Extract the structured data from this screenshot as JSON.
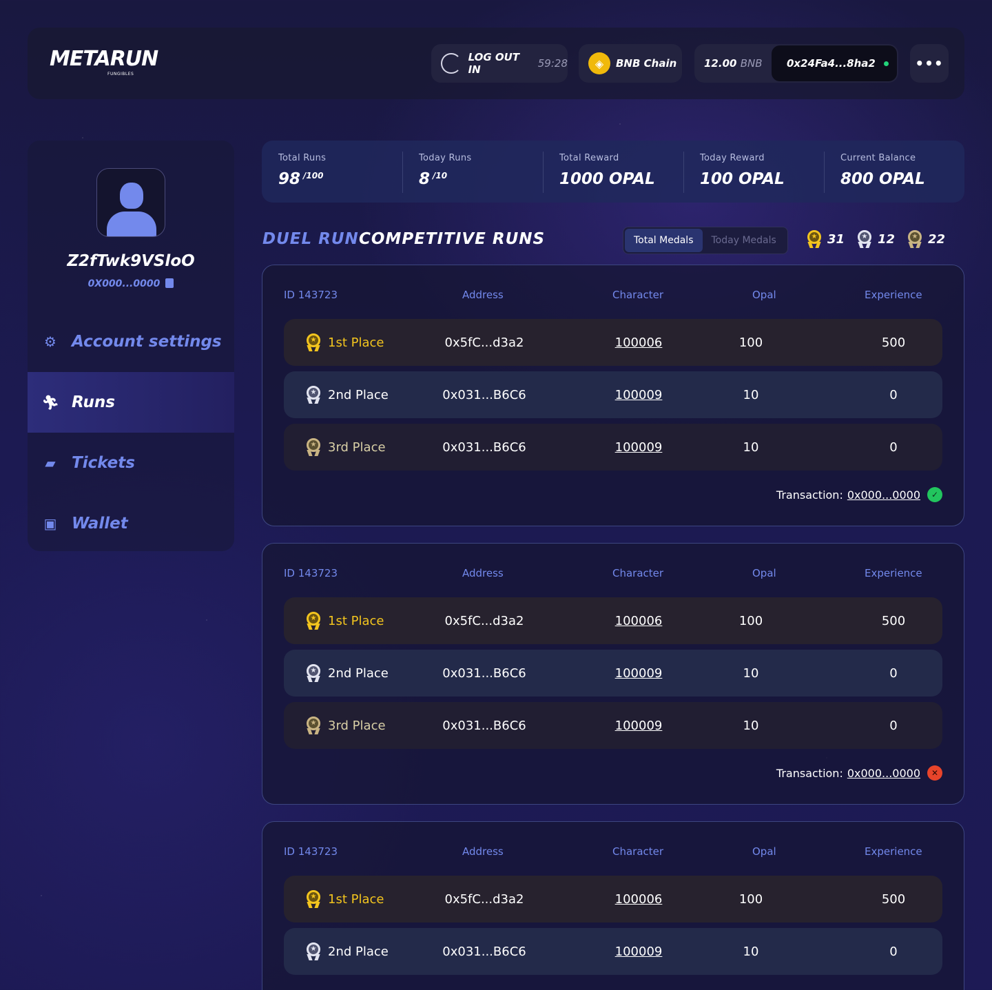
{
  "header": {
    "logo": "METARUN",
    "logo_sub": "FUNGIBLES",
    "logout_label": "LOG OUT IN",
    "logout_timer": "59:28",
    "chain_label": "BNB Chain",
    "balance_amount": "12.00",
    "balance_unit": "BNB",
    "wallet_address": "0x24Fa4...8ha2",
    "more_label": "•••"
  },
  "profile": {
    "username": "Z2fTwk9VSloO",
    "address": "0X000...0000"
  },
  "sidebar": {
    "items": [
      {
        "label": "Account settings",
        "icon": "gear-icon"
      },
      {
        "label": "Runs",
        "icon": "runner-icon"
      },
      {
        "label": "Tickets",
        "icon": "ticket-icon"
      },
      {
        "label": "Wallet",
        "icon": "wallet-icon"
      }
    ]
  },
  "stats": [
    {
      "label": "Total Runs",
      "value": "98",
      "max": "/100"
    },
    {
      "label": "Today Runs",
      "value": "8",
      "max": "/10"
    },
    {
      "label": "Total Reward",
      "value": "1000 OPAL",
      "max": ""
    },
    {
      "label": "Today Reward",
      "value": "100 OPAL",
      "max": ""
    },
    {
      "label": "Current Balance",
      "value": "800 OPAL",
      "max": ""
    }
  ],
  "runs_tabs": {
    "duel": "DUEL RUN",
    "competitive": "COMPETITIVE RUNS"
  },
  "medal_tabs": {
    "total": "Total Medals",
    "today": "Today Medals"
  },
  "medals": {
    "gold": "31",
    "silver": "12",
    "bronze": "22"
  },
  "columns": {
    "address": "Address",
    "character": "Character",
    "opal": "Opal",
    "experience": "Experience"
  },
  "runs": [
    {
      "id": "ID 143723",
      "results": [
        {
          "place": "1st Place",
          "address": "0x5fC...d3a2",
          "character": "100006",
          "opal": "100",
          "experience": "500"
        },
        {
          "place": "2nd Place",
          "address": "0x031...B6C6",
          "character": "100009",
          "opal": "10",
          "experience": "0"
        },
        {
          "place": "3rd Place",
          "address": "0x031...B6C6",
          "character": "100009",
          "opal": "10",
          "experience": "0"
        }
      ],
      "transaction_label": "Transaction:",
      "transaction": "0x000...0000",
      "status": "success"
    },
    {
      "id": "ID 143723",
      "results": [
        {
          "place": "1st Place",
          "address": "0x5fC...d3a2",
          "character": "100006",
          "opal": "100",
          "experience": "500"
        },
        {
          "place": "2nd Place",
          "address": "0x031...B6C6",
          "character": "100009",
          "opal": "10",
          "experience": "0"
        },
        {
          "place": "3rd Place",
          "address": "0x031...B6C6",
          "character": "100009",
          "opal": "10",
          "experience": "0"
        }
      ],
      "transaction_label": "Transaction:",
      "transaction": "0x000...0000",
      "status": "failed"
    },
    {
      "id": "ID 143723",
      "results": [
        {
          "place": "1st Place",
          "address": "0x5fC...d3a2",
          "character": "100006",
          "opal": "100",
          "experience": "500"
        },
        {
          "place": "2nd Place",
          "address": "0x031...B6C6",
          "character": "100009",
          "opal": "10",
          "experience": "0"
        }
      ]
    }
  ],
  "colors": {
    "accent": "#7389ec",
    "gold": "#f3c51e",
    "success": "#22c55e",
    "error": "#e8442a"
  }
}
